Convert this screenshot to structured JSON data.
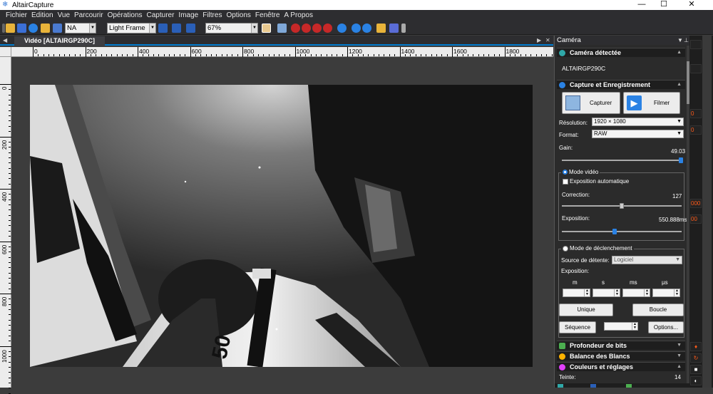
{
  "window": {
    "title": "AltairCapture",
    "minimize": "—",
    "maximize": "☐",
    "close": "✕"
  },
  "menu": [
    "Fichier",
    "Edition",
    "Vue",
    "Parcourir",
    "Opérations",
    "Capturer",
    "Image",
    "Filtres",
    "Options",
    "Fenêtre",
    "A Propos"
  ],
  "toolbar": {
    "filter_value": "NA",
    "frame_type": "Light Frame",
    "zoom": "67%"
  },
  "document_tab": {
    "label": "Vidéo [ALTAIRGP290C]"
  },
  "ruler": {
    "h_labels": [
      "0",
      "200",
      "400",
      "600",
      "800",
      "1000",
      "1200",
      "1400",
      "1600",
      "1800"
    ],
    "v_labels": [
      "0",
      "200",
      "400",
      "600",
      "800",
      "1000"
    ]
  },
  "video_overlay_text": "50",
  "panel": {
    "title": "Caméra",
    "camera_detected": {
      "title": "Caméra détectée",
      "camera_name": "ALTAIRGP290C"
    },
    "capture": {
      "title": "Capture et Enregistrement",
      "capture_label": "Capturer",
      "film_label": "Filmer",
      "resolution_label": "Résolution:",
      "resolution_value": "1920 × 1080",
      "format_label": "Format:",
      "format_value": "RAW",
      "gain_label": "Gain:",
      "gain_value": "49.03",
      "gain_level": 0.98
    },
    "video_mode": {
      "title": "Mode vidéo",
      "auto_exposure": "Exposition automatique",
      "correction_label": "Correction:",
      "correction_value": "127",
      "correction_level": 0.5,
      "exposure_label": "Exposition:",
      "exposure_value": "550.888ms",
      "exposure_level": 0.44
    },
    "trigger_mode": {
      "title": "Mode de déclenchement",
      "source_label": "Source de détente:",
      "source_value": "Logiciel",
      "exposure_label": "Exposition:",
      "units": [
        "m",
        "s",
        "ms",
        "µs"
      ],
      "single_label": "Unique",
      "loop_label": "Boucle",
      "sequence_label": "Séquence",
      "options_label": "Options..."
    },
    "bit_depth": {
      "title": "Profondeur de bits"
    },
    "white_balance": {
      "title": "Balance des Blancs"
    },
    "colors": {
      "title": "Couleurs et réglages",
      "tint_label": "Teinte:",
      "tint_value": "14"
    }
  },
  "right_strip": {
    "values": [
      "0",
      "0",
      "000",
      "00"
    ]
  }
}
